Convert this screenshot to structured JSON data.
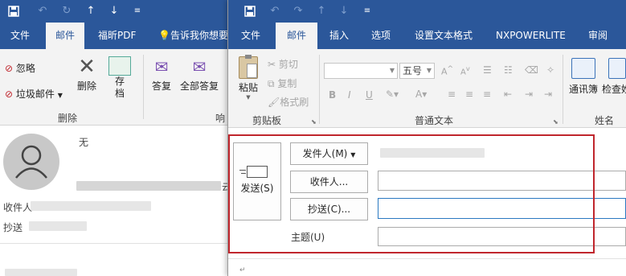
{
  "back_window": {
    "qat": {
      "save_icon": "save-icon",
      "undo_icon": "undo-icon",
      "redo_icon": "redo-icon",
      "up_icon": "arrow-up-icon",
      "down_icon": "arrow-down-icon",
      "customize_icon": "customize-qat-icon"
    },
    "tabs": [
      "文件",
      "邮件",
      "福昕PDF",
      "告诉我你想要"
    ],
    "active_tab": "邮件",
    "ribbon": {
      "ignore": "忽略",
      "junk": "垃圾邮件",
      "delete": "删除",
      "archive": "存\n档",
      "reply": "答复",
      "reply_all": "全部答复",
      "group_delete": "删除",
      "group_respond_partial": "响"
    },
    "reading_pane": {
      "subject": "无",
      "to_label": "收件人",
      "cc_label": "抄送",
      "cut_text": "云"
    }
  },
  "front_window": {
    "qat": {
      "save_icon": "save-icon",
      "undo_icon": "undo-icon",
      "redo_icon": "redo-icon",
      "up_icon": "arrow-up-icon",
      "down_icon": "arrow-down-icon",
      "customize_icon": "customize-qat-icon"
    },
    "tabs": [
      "文件",
      "邮件",
      "插入",
      "选项",
      "设置文本格式",
      "NXPOWERLITE",
      "审阅"
    ],
    "active_tab": "邮件",
    "ribbon": {
      "paste": "粘贴",
      "cut": "剪切",
      "copy": "复制",
      "format_painter": "格式刷",
      "group_clipboard": "剪贴板",
      "font_name": "",
      "font_size": "五号",
      "group_basic_text": "普通文本",
      "address_book": "通讯簿",
      "check_names": "检查姓",
      "group_names": "姓名",
      "format_buttons": [
        "B",
        "I",
        "U"
      ]
    },
    "compose": {
      "send": "发送(S)",
      "from": "发件人(M)",
      "to": "收件人...",
      "cc": "抄送(C)...",
      "subject_label": "主题(U)",
      "to_value": "",
      "cc_value": "",
      "subject_value": ""
    },
    "highlight_color": "#c0262d",
    "accent_color": "#2b579a"
  }
}
